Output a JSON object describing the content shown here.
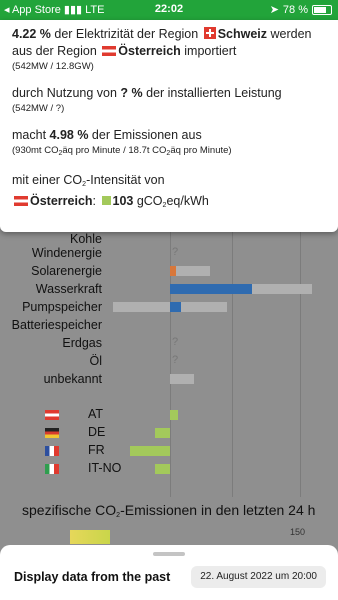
{
  "status_bar": {
    "carrier": "◂ App Store",
    "network": "LTE",
    "time": "22:02",
    "battery": "78 %"
  },
  "popup": {
    "line1_pct": "4.22 %",
    "line1_a": " der Elektrizität der Region ",
    "line1_region_from": "Schweiz",
    "line1_b": " werden aus der Region ",
    "line1_region_to": "Österreich",
    "line1_c": " importiert",
    "line1_small": "(542MW / 12.8GW)",
    "line2_a": "durch Nutzung von ",
    "line2_pct": "? %",
    "line2_b": " der installierten Leistung",
    "line2_small": "(542MW / ?)",
    "line3_a": "macht ",
    "line3_pct": "4.98 %",
    "line3_b": " der Emissionen aus",
    "line3_small_a": "(930mt CO",
    "line3_small_sub": "2",
    "line3_small_b": "äq pro Minute / 18.7t CO",
    "line3_small_sub2": "2",
    "line3_small_c": "äq pro Minute)",
    "line4_a": "mit einer CO",
    "line4_sub": "2",
    "line4_b": "-Intensität von",
    "line5_region": "Österreich",
    "line5_colon": ":",
    "line5_value": "103",
    "line5_unit_a": " gCO",
    "line5_unit_sub": "2",
    "line5_unit_b": "eq/kWh"
  },
  "chart_data": {
    "type": "bar",
    "categories": [
      "Kohle",
      "Windenergie",
      "Solarenergie",
      "Wasserkraft",
      "Pumpspeicher",
      "Batteriespeicher",
      "Erdgas",
      "Öl",
      "unbekannt"
    ],
    "countries": [
      "AT",
      "DE",
      "FR",
      "IT-NO"
    ],
    "unknown_marker": "?"
  },
  "subtitle_a": "spezifische CO",
  "subtitle_sub": "2",
  "subtitle_b": "-Emissionen in den letzten 24 h",
  "tick_150": "150",
  "sheet": {
    "title": "Display data from the past",
    "date": "22. August 2022 um 20:00"
  }
}
